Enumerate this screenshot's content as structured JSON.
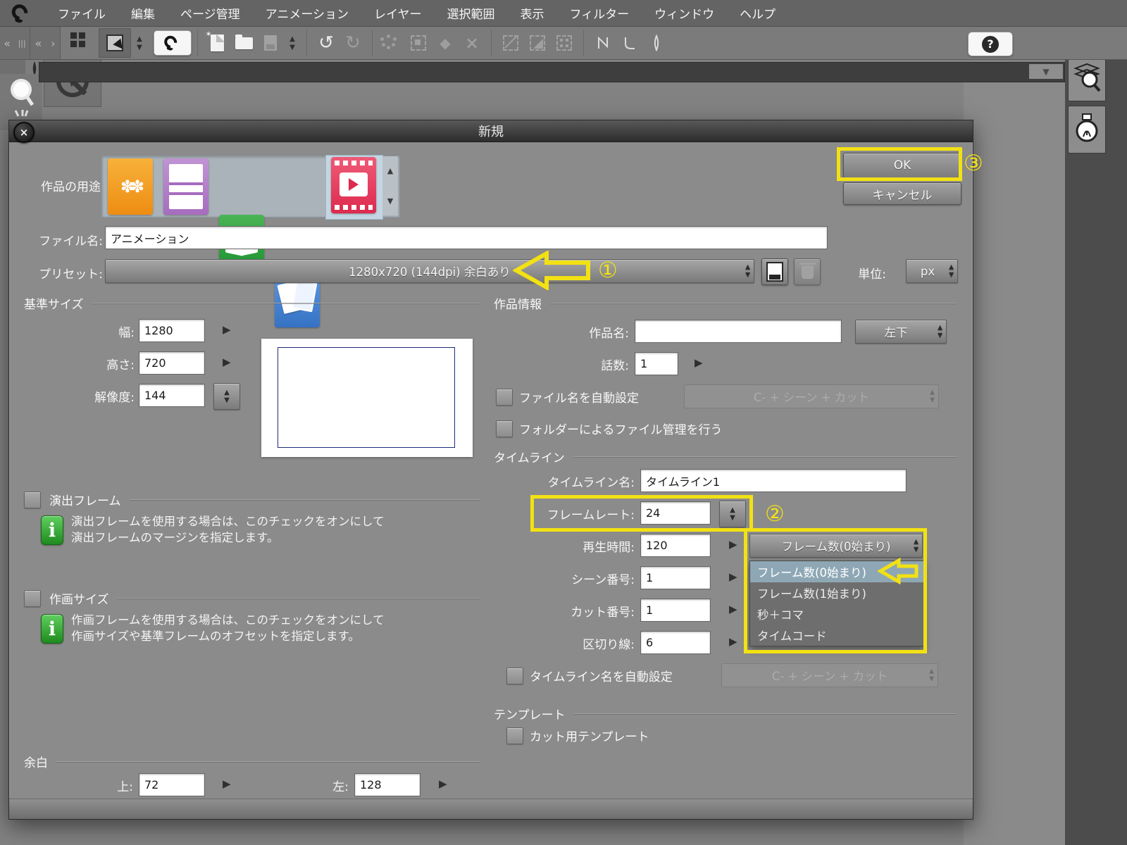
{
  "menubar": {
    "items": [
      "ファイル",
      "編集",
      "ページ管理",
      "アニメーション",
      "レイヤー",
      "選択範囲",
      "表示",
      "フィルター",
      "ウィンドウ",
      "ヘルプ"
    ]
  },
  "icons": {
    "collapse_left": "«",
    "grip": "|||",
    "expand_right": "›",
    "prev": "‹",
    "next": "»",
    "undo": "↺",
    "redo": "↻",
    "help": "?",
    "spin_up": "▲",
    "spin_down": "▼",
    "row_arrow": "▶",
    "dd_down": "▼",
    "close": "×",
    "bucket": "◆",
    "transform": "×",
    "new_sparkle": "✶",
    "flower": "✽✽"
  },
  "dialog": {
    "title": "新規",
    "usage_label": "作品の用途",
    "ok_label": "OK",
    "cancel_label": "キャンセル",
    "file_name_label": "ファイル名:",
    "file_name_value": "アニメーション",
    "preset_label": "プリセット:",
    "preset_value": "1280x720 (144dpi) 余白あり",
    "unit_label": "単位:",
    "unit_value": "px",
    "base_size": {
      "group_label": "基準サイズ",
      "width_label": "幅:",
      "width_value": "1280",
      "height_label": "高さ:",
      "height_value": "720",
      "dpi_label": "解像度:",
      "dpi_value": "144"
    },
    "direction_frame": {
      "label": "演出フレーム",
      "info_line1": "演出フレームを使用する場合は、このチェックをオンにして",
      "info_line2": "演出フレームのマージンを指定します。"
    },
    "drawing_size": {
      "label": "作画サイズ",
      "info_line1": "作画フレームを使用する場合は、このチェックをオンにして",
      "info_line2": "作画サイズや基準フレームのオフセットを指定します。"
    },
    "margin": {
      "group_label": "余白",
      "top_label": "上:",
      "top_value": "72",
      "left_label": "左:",
      "left_value": "128"
    },
    "work_info": {
      "group_label": "作品情報",
      "work_name_label": "作品名:",
      "position_value": "左下",
      "episode_label": "話数:",
      "episode_value": "1",
      "auto_filename_label": "ファイル名を自動設定",
      "auto_filename_value": "C- + シーン + カット",
      "folder_manage_label": "フォルダーによるファイル管理を行う"
    },
    "timeline": {
      "group_label": "タイムライン",
      "name_label": "タイムライン名:",
      "name_value": "タイムライン1",
      "framerate_label": "フレームレート:",
      "framerate_value": "24",
      "playtime_label": "再生時間:",
      "playtime_value": "120",
      "scale_value": "フレーム数(0始まり)",
      "scale_options": [
        "フレーム数(0始まり)",
        "フレーム数(1始まり)",
        "秒＋コマ",
        "タイムコード"
      ],
      "scene_label": "シーン番号:",
      "scene_value": "1",
      "cut_label": "カット番号:",
      "cut_value": "1",
      "separator_label": "区切り線:",
      "separator_value": "6",
      "auto_name_label": "タイムライン名を自動設定",
      "auto_name_value": "C- + シーン + カット"
    },
    "template": {
      "group_label": "テンプレート",
      "cut_template_label": "カット用テンプレート"
    }
  },
  "annotations": {
    "one": "①",
    "two": "②",
    "three": "③",
    "highlight_color": "#f2e113"
  }
}
